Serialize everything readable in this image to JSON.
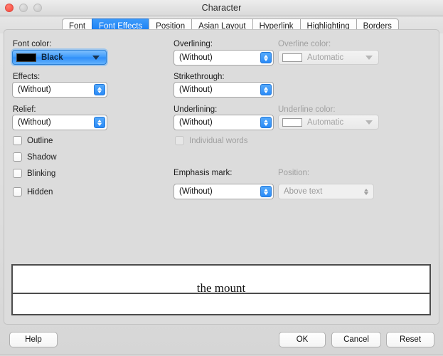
{
  "window": {
    "title": "Character",
    "controls": {
      "close": "close-button",
      "minimize": "minimize-button",
      "maximize": "maximize-button"
    }
  },
  "tabs": [
    {
      "label": "Font",
      "active": false
    },
    {
      "label": "Font Effects",
      "active": true
    },
    {
      "label": "Position",
      "active": false
    },
    {
      "label": "Asian Layout",
      "active": false
    },
    {
      "label": "Hyperlink",
      "active": false
    },
    {
      "label": "Highlighting",
      "active": false
    },
    {
      "label": "Borders",
      "active": false
    }
  ],
  "left_column": {
    "font_color_label": "Font color:",
    "font_color_value": "Black",
    "font_color_swatch": "#000000",
    "effects_label": "Effects:",
    "effects_value": "(Without)",
    "relief_label": "Relief:",
    "relief_value": "(Without)",
    "checkboxes": [
      {
        "label": "Outline",
        "checked": false,
        "enabled": true
      },
      {
        "label": "Shadow",
        "checked": false,
        "enabled": true
      },
      {
        "label": "Blinking",
        "checked": false,
        "enabled": true
      },
      {
        "label": "Hidden",
        "checked": false,
        "enabled": true
      }
    ]
  },
  "middle_column": {
    "overlining_label": "Overlining:",
    "overlining_value": "(Without)",
    "strikethrough_label": "Strikethrough:",
    "strikethrough_value": "(Without)",
    "underlining_label": "Underlining:",
    "underlining_value": "(Without)",
    "individual_words_label": "Individual words",
    "individual_words_checked": false,
    "individual_words_enabled": false,
    "emphasis_mark_label": "Emphasis mark:",
    "emphasis_mark_value": "(Without)"
  },
  "right_column": {
    "overline_color_label": "Overline color:",
    "overline_color_value": "Automatic",
    "overline_color_enabled": false,
    "underline_color_label": "Underline color:",
    "underline_color_value": "Automatic",
    "underline_color_enabled": false,
    "position_label": "Position:",
    "position_value": "Above text",
    "position_enabled": false
  },
  "preview": {
    "sample_text": "the mount"
  },
  "buttons": {
    "help": "Help",
    "ok": "OK",
    "cancel": "Cancel",
    "reset": "Reset"
  },
  "colors": {
    "accent": "#1279f3",
    "window_bg": "#dcdcdc",
    "disabled_text": "#a0a0a0"
  }
}
